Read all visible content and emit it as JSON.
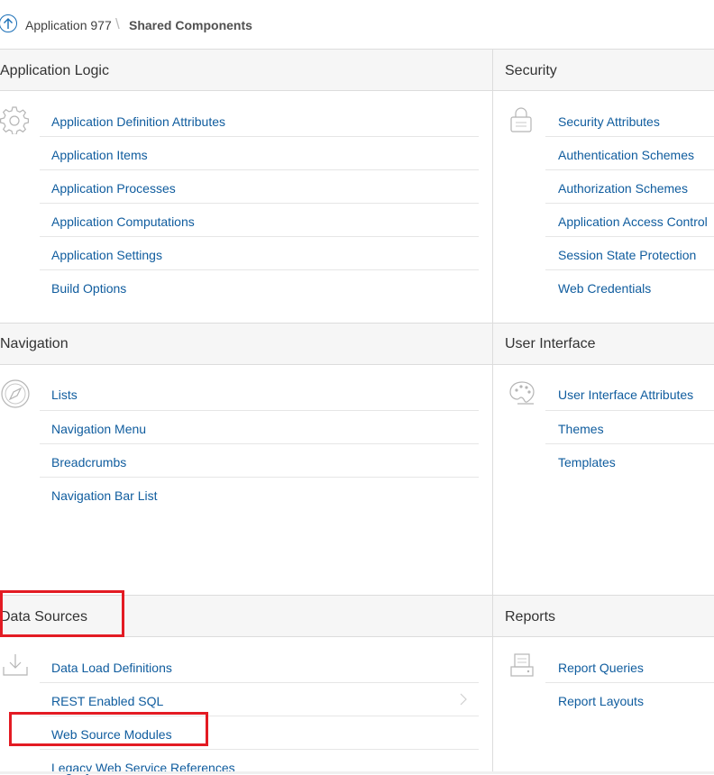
{
  "breadcrumb": {
    "parent": "Application 977",
    "separator": "\\",
    "current": "Shared Components"
  },
  "regions": {
    "application_logic": {
      "title": "Application Logic",
      "icon": "gear-icon",
      "links": [
        "Application Definition Attributes",
        "Application Items",
        "Application Processes",
        "Application Computations",
        "Application Settings",
        "Build Options"
      ]
    },
    "security": {
      "title": "Security",
      "icon": "lock-icon",
      "links": [
        "Security Attributes",
        "Authentication Schemes",
        "Authorization Schemes",
        "Application Access Control",
        "Session State Protection",
        "Web Credentials"
      ]
    },
    "navigation": {
      "title": "Navigation",
      "icon": "compass-icon",
      "links": [
        "Lists",
        "Navigation Menu",
        "Breadcrumbs",
        "Navigation Bar List"
      ]
    },
    "user_interface": {
      "title": "User Interface",
      "icon": "palette-icon",
      "links": [
        "User Interface Attributes",
        "Themes",
        "Templates"
      ]
    },
    "data_sources": {
      "title": "Data Sources",
      "icon": "download-icon",
      "links": [
        "Data Load Definitions",
        "REST Enabled SQL",
        "Web Source Modules",
        "Legacy Web Service References"
      ]
    },
    "reports": {
      "title": "Reports",
      "icon": "printer-icon",
      "links": [
        "Report Queries",
        "Report Layouts"
      ]
    }
  },
  "colors": {
    "link": "#0f5c9e",
    "highlight": "#e31b23",
    "header_band": "#f6f6f6"
  }
}
